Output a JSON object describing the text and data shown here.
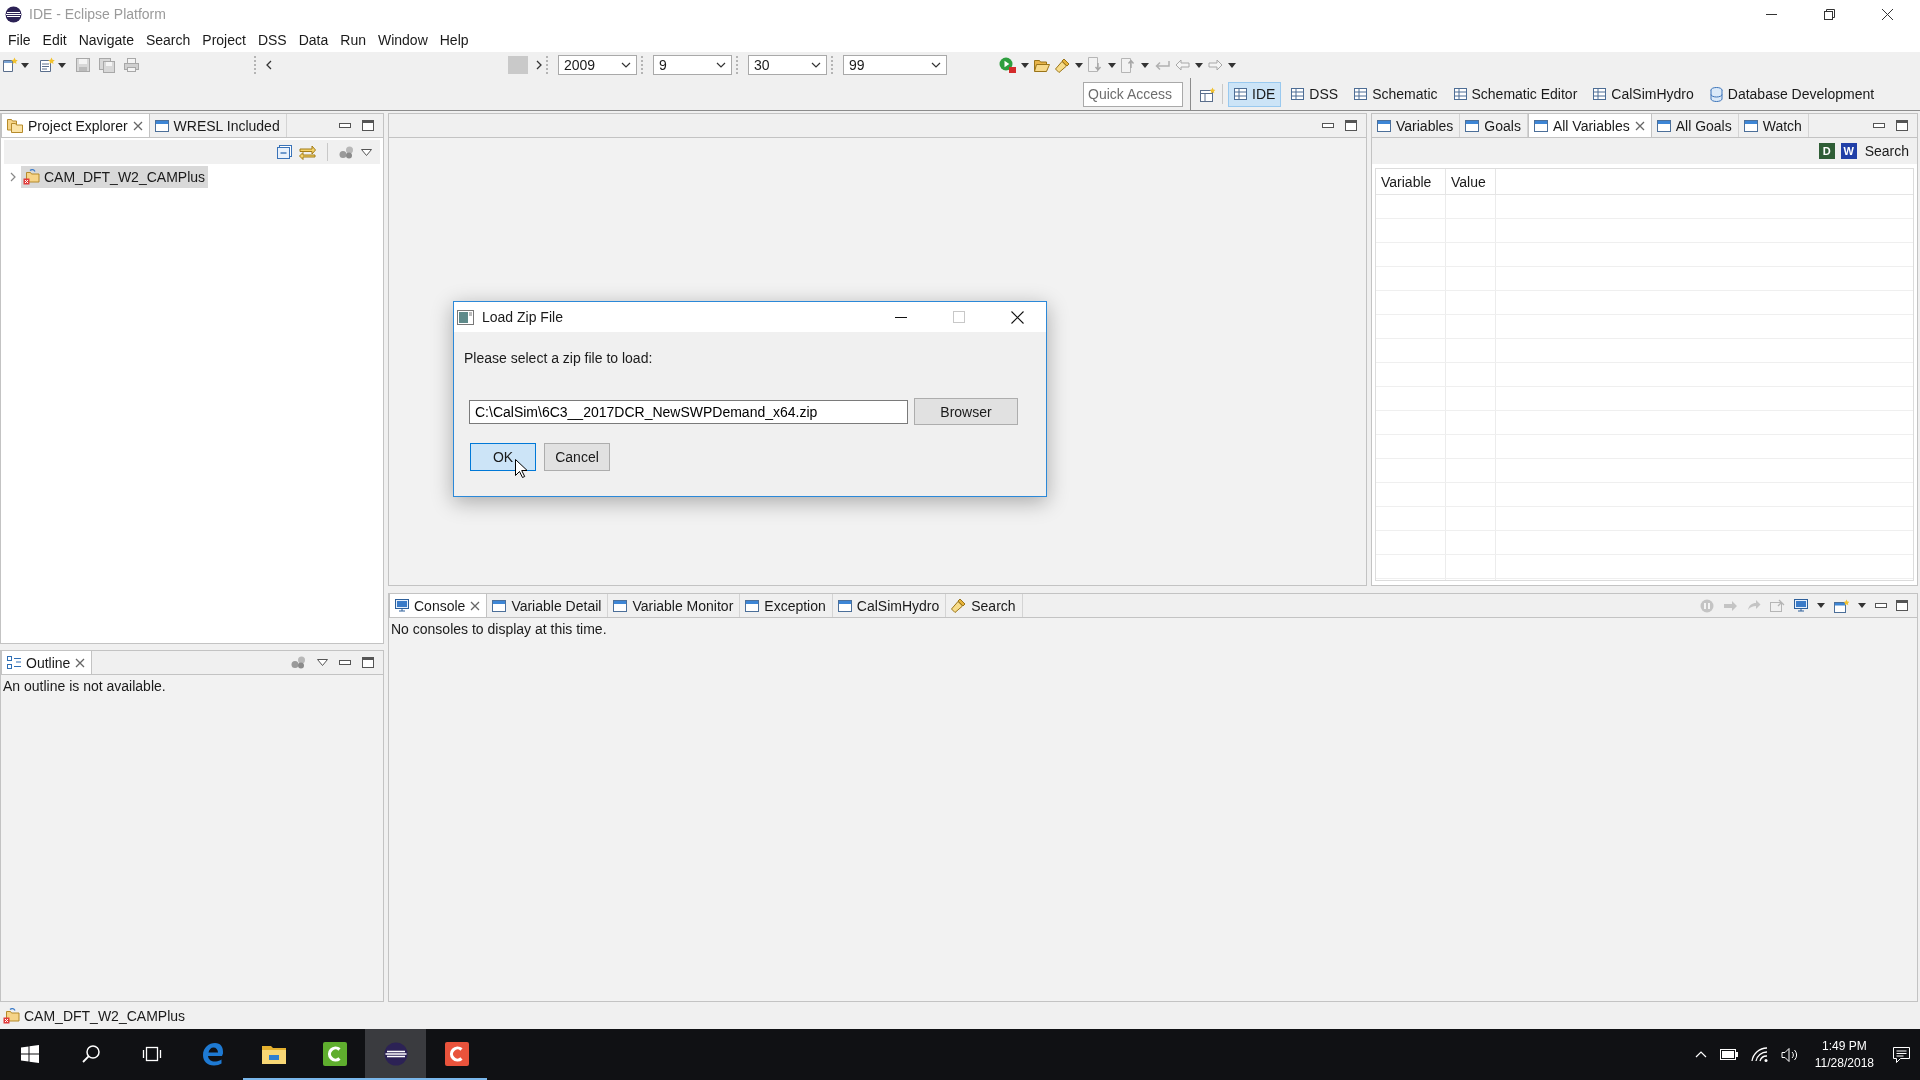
{
  "window": {
    "title": "IDE - Eclipse Platform"
  },
  "menu_bar": [
    "File",
    "Edit",
    "Navigate",
    "Search",
    "Project",
    "DSS",
    "Data",
    "Run",
    "Window",
    "Help"
  ],
  "toolbar": {
    "date_combos": [
      {
        "value": "2009"
      },
      {
        "value": "9"
      },
      {
        "value": "30"
      },
      {
        "value": "99"
      }
    ]
  },
  "quick_access": {
    "placeholder": "Quick Access"
  },
  "perspectives": [
    {
      "label": "IDE",
      "selected": true
    },
    {
      "label": "DSS",
      "selected": false
    },
    {
      "label": "Schematic",
      "selected": false
    },
    {
      "label": "Schematic Editor",
      "selected": false
    },
    {
      "label": "CalSimHydro",
      "selected": false
    },
    {
      "label": "Database Development",
      "selected": false
    }
  ],
  "project_explorer": {
    "tabs": [
      {
        "label": "Project Explorer",
        "selected": true
      },
      {
        "label": "WRESL Included",
        "selected": false
      }
    ],
    "tree": [
      {
        "label": "CAM_DFT_W2_CAMPlus",
        "expanded": false,
        "selected": true
      }
    ]
  },
  "outline": {
    "tabs": [
      {
        "label": "Outline",
        "selected": true
      }
    ],
    "message": "An outline is not available."
  },
  "variables_view": {
    "tabs": [
      {
        "label": "Variables",
        "selected": false
      },
      {
        "label": "Goals",
        "selected": false
      },
      {
        "label": "All Variables",
        "selected": true
      },
      {
        "label": "All Goals",
        "selected": false
      },
      {
        "label": "Watch",
        "selected": false
      }
    ],
    "tool_buttons": [
      {
        "label": "D",
        "color": "#2f5e36"
      },
      {
        "label": "W",
        "color": "#2140a8"
      }
    ],
    "search_button": "Search",
    "table": {
      "columns": [
        "Variable",
        "Value"
      ]
    }
  },
  "console_view": {
    "tabs": [
      {
        "label": "Console",
        "selected": true
      },
      {
        "label": "Variable Detail",
        "selected": false
      },
      {
        "label": "Variable Monitor",
        "selected": false
      },
      {
        "label": "Exception",
        "selected": false
      },
      {
        "label": "CalSimHydro",
        "selected": false
      },
      {
        "label": "Search",
        "selected": false
      }
    ],
    "message": "No consoles to display at this time."
  },
  "status_bar": {
    "text": "CAM_DFT_W2_CAMPlus"
  },
  "dialog": {
    "title": "Load Zip File",
    "prompt": "Please select a zip file to load:",
    "path_field": {
      "value": "C:\\CalSim\\6C3__2017DCR_NewSWPDemand_x64.zip"
    },
    "browse_button": "Browser",
    "buttons": [
      {
        "label": "OK",
        "default": true
      },
      {
        "label": "Cancel",
        "default": false
      }
    ]
  },
  "taskbar": {
    "apps": [
      {
        "kind": "e-logo",
        "running": false,
        "selected": false
      },
      {
        "kind": "folder",
        "running": true,
        "selected": false
      },
      {
        "kind": "green-tile",
        "running": true,
        "selected": false
      },
      {
        "kind": "striped-circle",
        "running": true,
        "selected": true
      },
      {
        "kind": "red-tile",
        "running": true,
        "selected": false
      }
    ],
    "clock": {
      "time": "1:49 PM",
      "date": "11/28/2018"
    }
  }
}
